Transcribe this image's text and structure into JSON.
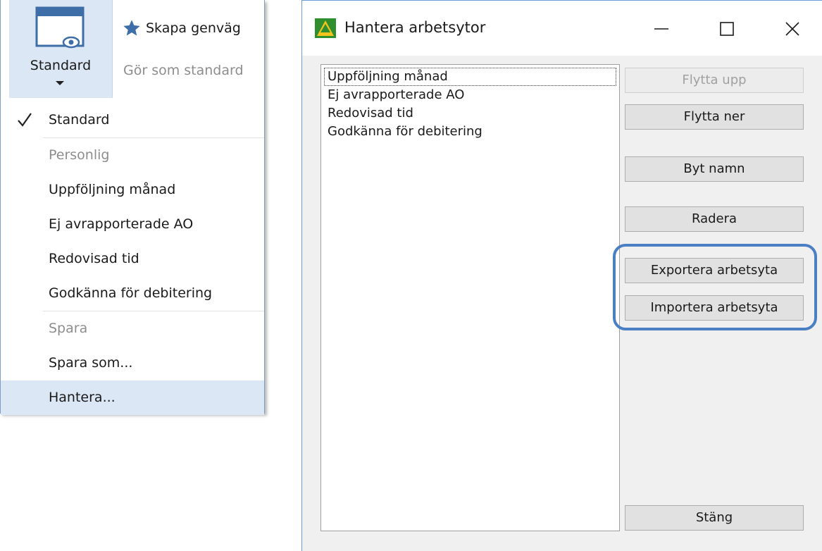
{
  "ribbon": {
    "standard_label": "Standard",
    "shortcut_label": "Skapa genväg",
    "make_default_label": "Gör som standard"
  },
  "menu": {
    "items": [
      {
        "label": "Standard",
        "checked": true,
        "disabled": false
      },
      {
        "label": "Personlig",
        "disabled": true
      },
      {
        "label": "Uppföljning månad",
        "disabled": false
      },
      {
        "label": "Ej avrapporterade AO",
        "disabled": false
      },
      {
        "label": "Redovisad tid",
        "disabled": false
      },
      {
        "label": "Godkänna för debitering",
        "disabled": false
      },
      {
        "label": "Spara",
        "disabled": true
      },
      {
        "label": "Spara som...",
        "disabled": false
      },
      {
        "label": "Hantera...",
        "disabled": false,
        "hover": true
      }
    ]
  },
  "dialog": {
    "title": "Hantera arbetsytor",
    "list": [
      "Uppföljning månad",
      "Ej avrapporterade AO",
      "Redovisad tid",
      "Godkänna för debitering"
    ],
    "buttons": {
      "move_up": "Flytta upp",
      "move_down": "Flytta ner",
      "rename": "Byt namn",
      "delete": "Radera",
      "export": "Exportera arbetsyta",
      "import": "Importera arbetsyta",
      "close": "Stäng"
    }
  },
  "colors": {
    "accent": "#4a7fc4",
    "ribbon_active": "#dce7f5",
    "disabled_text": "#8d8d8d"
  }
}
